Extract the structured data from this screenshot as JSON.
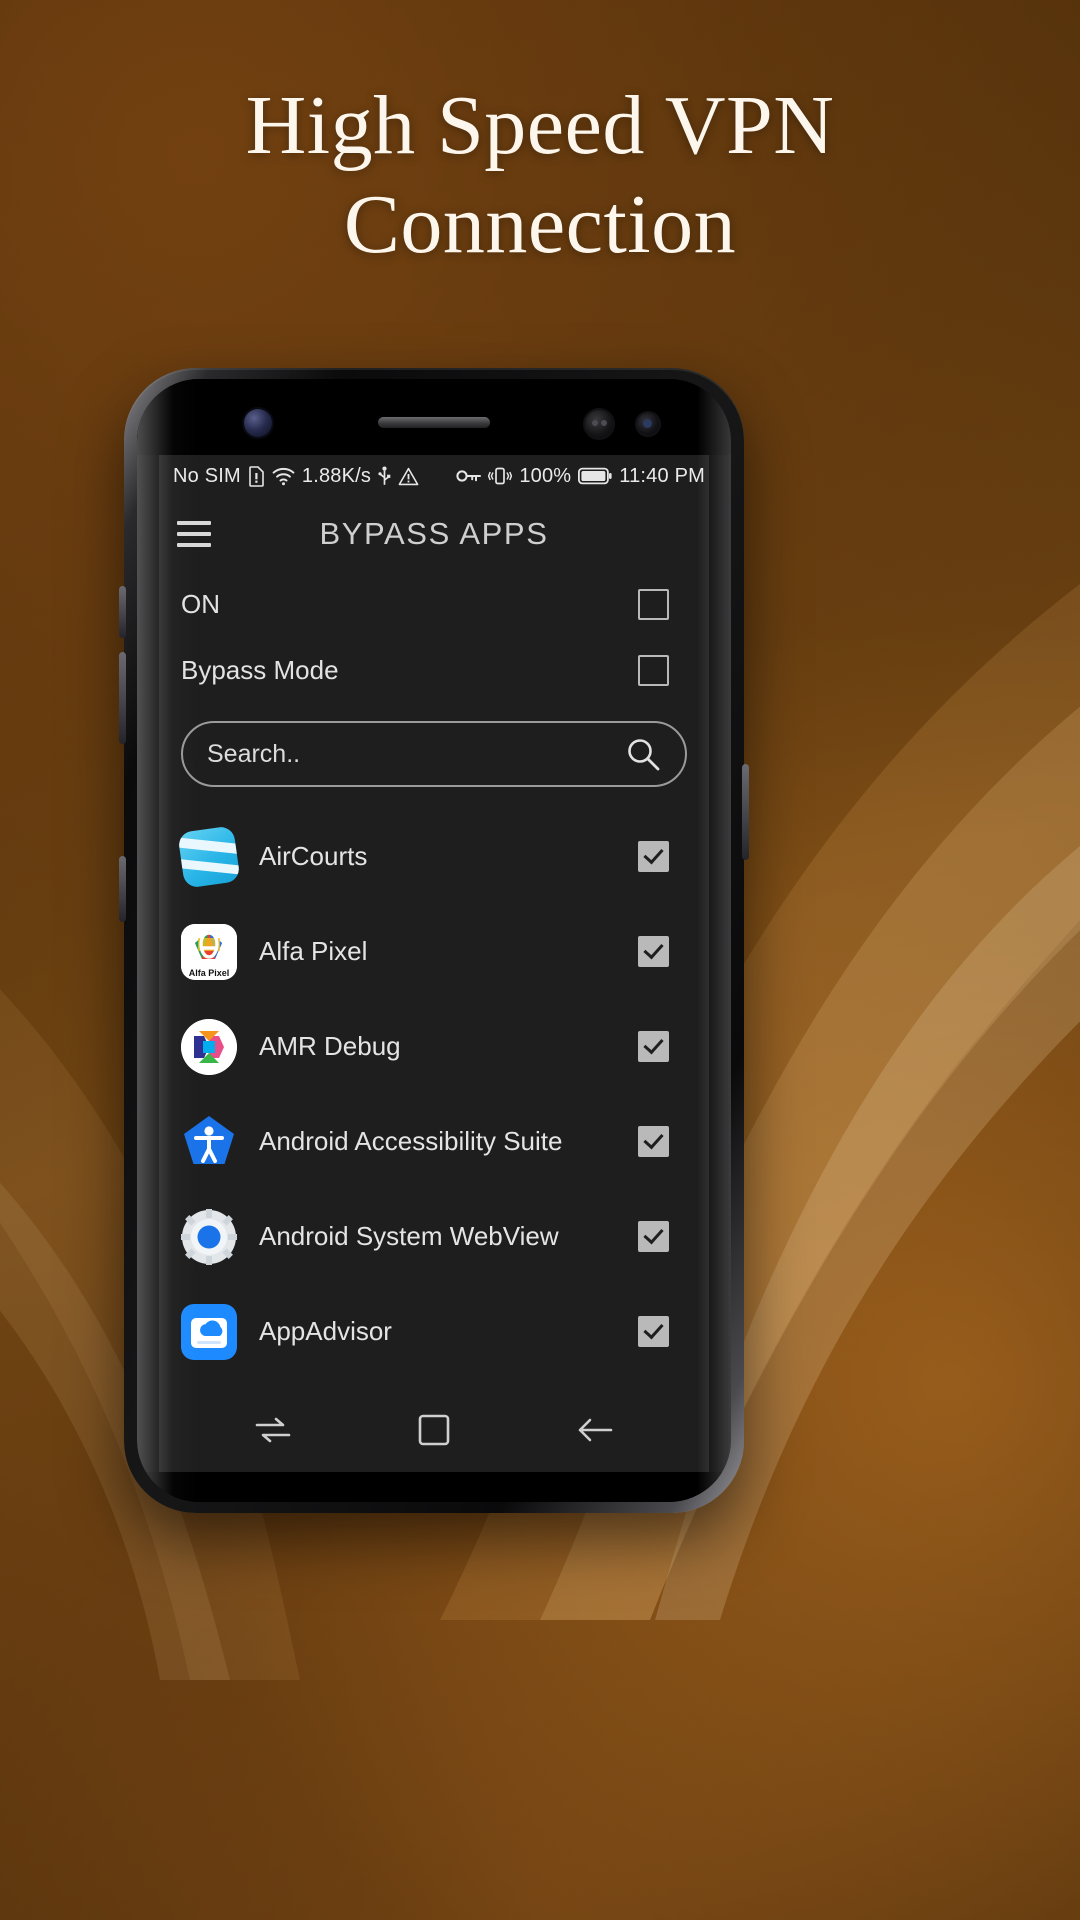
{
  "promo": {
    "headline_line1": "High Speed VPN",
    "headline_line2": "Connection",
    "background_color": "#5b360d",
    "headline_color": "#fdf6ec"
  },
  "statusbar": {
    "carrier": "No SIM",
    "sim_icon": "sim-card-alert-icon",
    "wifi_icon": "wifi-icon",
    "network_speed": "1.88K/s",
    "usb_icon": "usb-icon",
    "warning_icon": "warning-triangle-icon",
    "key_icon": "vpn-key-icon",
    "vibrate_icon": "vibrate-icon",
    "battery_percent": "100%",
    "battery_icon": "battery-full-icon",
    "time": "11:40 PM"
  },
  "appbar": {
    "menu_icon": "hamburger-menu-icon",
    "title": "BYPASS APPS"
  },
  "toggles": [
    {
      "label": "ON",
      "checked": false
    },
    {
      "label": "Bypass Mode",
      "checked": false
    }
  ],
  "search": {
    "placeholder": "Search..",
    "value": "",
    "icon": "search-icon"
  },
  "apps": [
    {
      "name": "AirCourts",
      "icon": "aircourts-icon",
      "icon_class": "ic-aircourts",
      "checked": true
    },
    {
      "name": "Alfa Pixel",
      "icon": "alfa-pixel-icon",
      "icon_class": "ic-alfa",
      "checked": true
    },
    {
      "name": "AMR Debug",
      "icon": "amr-debug-icon",
      "icon_class": "ic-amr",
      "checked": true
    },
    {
      "name": "Android Accessibility Suite",
      "icon": "android-accessibility-icon",
      "icon_class": "ic-a11y",
      "checked": true
    },
    {
      "name": "Android System WebView",
      "icon": "android-webview-icon",
      "icon_class": "ic-webview",
      "checked": true
    },
    {
      "name": "AppAdvisor",
      "icon": "appadvisor-icon",
      "icon_class": "ic-appadv",
      "checked": true
    }
  ],
  "navbar": {
    "recents_label": "recents-icon",
    "home_label": "home-icon",
    "back_label": "back-icon"
  },
  "colors": {
    "screen_bg": "#1e1e1e",
    "accent_brown": "#6d4312",
    "text_primary": "#e4e4e4"
  }
}
